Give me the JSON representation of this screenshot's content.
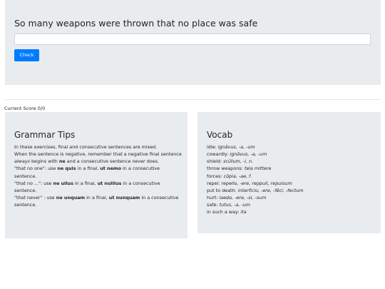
{
  "exercise": {
    "sentence": "So many weapons were thrown that no place was safe",
    "answer_value": "",
    "check_label": "Check"
  },
  "score": {
    "label": "Current Score",
    "value": "0/0"
  },
  "grammar": {
    "title": "Grammar Tips",
    "intro": "In these exercises, final and consecutive sentences are mixed.",
    "negative": {
      "t1": "When the sentence is negative, remember that a negative final sentence ",
      "always": "always",
      "t2": " begins with ",
      "ne": "ne",
      "t3": " and a consecutive sentence ",
      "never": "never",
      "t4": " does."
    },
    "rules": [
      {
        "t1": "\"that no one\": use ",
        "final": "ne quis",
        "t2": " in a final, ",
        "consec": "ut nemo",
        "t3": " in a consecutive sentence."
      },
      {
        "t1": "\"that no ...\": use ",
        "final": "ne ullus",
        "t2": " in a final, ",
        "consec": "ut nullius",
        "t3": " in a consecutive sentence."
      },
      {
        "t1": "\"that never\" : use ",
        "final": "ne unquam",
        "t2": " in a final, ",
        "consec": "ut nunquam",
        "t3": " in a consecutive sentence."
      }
    ]
  },
  "vocab": {
    "title": "Vocab",
    "items": [
      {
        "en": "idle: ",
        "la": "ignāvus, -a, -um"
      },
      {
        "en": "cowardly: ",
        "la": "ignāvus, -a, -um"
      },
      {
        "en": "shield: ",
        "la": "scūtum, -i, n."
      },
      {
        "en": "throw weapons: ",
        "la": "tela mittere"
      },
      {
        "en": "forces: ",
        "la": "cōpia, -ae, f."
      },
      {
        "en": "repel: ",
        "la": "repello, -ere, reppuli, repulsum"
      },
      {
        "en": "put to death: ",
        "la": "interficio, -ere, -fēci, -fectum"
      },
      {
        "en": "hurt: ",
        "la": "laedo, -ere, -si, -sum"
      },
      {
        "en": "safe: ",
        "la": "tutus, -a, -um"
      },
      {
        "en": "in such a way: ",
        "la": "ita"
      }
    ]
  }
}
